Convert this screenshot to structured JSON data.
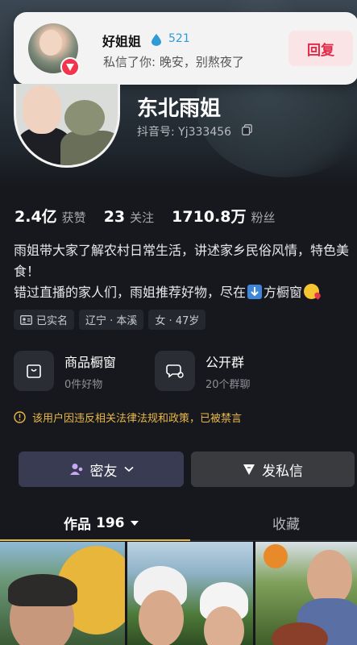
{
  "notification": {
    "sender_name": "好姐姐",
    "fan_level": "521",
    "message": "私信了你: 晚安，别熬夜了",
    "reply_label": "回复"
  },
  "profile": {
    "name": "东北雨姐",
    "douyin_id": "抖音号: Yj333456"
  },
  "stats": [
    {
      "value": "2.4亿",
      "label": "获赞"
    },
    {
      "value": "23",
      "label": "关注"
    },
    {
      "value": "1710.8万",
      "label": "粉丝"
    }
  ],
  "bio": {
    "line1": "雨姐带大家了解农村日常生活，讲述家乡民俗风情，特色美食！",
    "line2_prefix": "错过直播的家人们，雨姐推荐好物，尽在",
    "line2_suffix": "方橱窗"
  },
  "tags": [
    "已实名",
    "辽宁 · 本溪",
    "女 · 47岁"
  ],
  "features": [
    {
      "title": "商品橱窗",
      "sub": "0件好物",
      "icon": "bag-icon"
    },
    {
      "title": "公开群",
      "sub": "20个群聊",
      "icon": "chat-icon"
    }
  ],
  "warning": "该用户因违反相关法律法规和政策，已被禁言",
  "buttons": {
    "friend": "密友",
    "message": "发私信"
  },
  "tabs": {
    "works_label": "作品",
    "works_count": "196",
    "favorites_label": "收藏"
  },
  "colors": {
    "accent_yellow": "#e8b93f",
    "reply_red": "#e3294a",
    "badge_red": "#f4344d",
    "friend_button": "#393b53"
  }
}
